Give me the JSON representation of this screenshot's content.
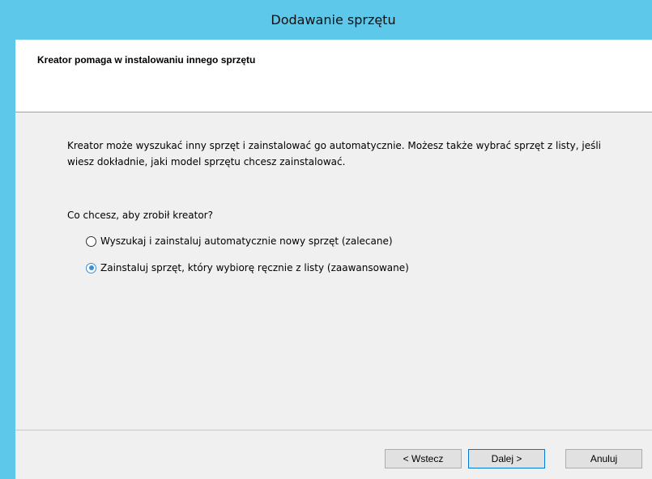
{
  "window": {
    "title": "Dodawanie sprzętu"
  },
  "header": {
    "title": "Kreator pomaga w instalowaniu innego sprzętu"
  },
  "body": {
    "description": "Kreator może wyszukać inny sprzęt i zainstalować go automatycznie. Możesz także wybrać sprzęt z listy, jeśli wiesz dokładnie, jaki model sprzętu chcesz zainstalować.",
    "question": "Co chcesz, aby zrobił kreator?",
    "options": [
      {
        "label": "Wyszukaj i zainstaluj automatycznie nowy sprzęt (zalecane)",
        "selected": false
      },
      {
        "label": "Zainstaluj sprzęt, który wybiorę ręcznie z listy (zaawansowane)",
        "selected": true
      }
    ]
  },
  "buttons": {
    "back": "< Wstecz",
    "next": "Dalej >",
    "cancel": "Anuluj"
  },
  "colors": {
    "titlebar": "#5ec8ea",
    "radio_selected": "#3b8fd6",
    "default_button_border": "#0078d7"
  }
}
